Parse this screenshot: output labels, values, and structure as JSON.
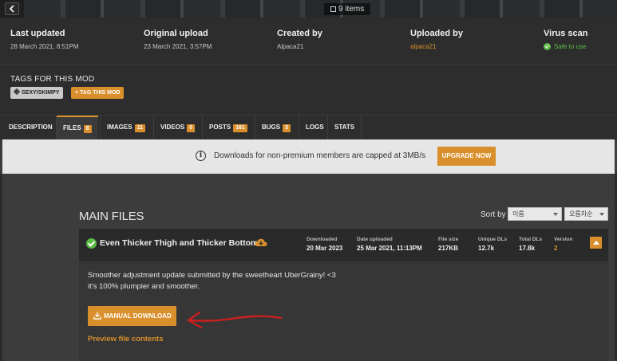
{
  "gallery": {
    "count": "9 items"
  },
  "meta": {
    "last_updated": {
      "label": "Last updated",
      "value": "28 March 2021,  8:51PM"
    },
    "original_upload": {
      "label": "Original upload",
      "value": "23 March 2021,  3:57PM"
    },
    "created_by": {
      "label": "Created by",
      "value": "Alpaca21"
    },
    "uploaded_by": {
      "label": "Uploaded by",
      "value": "alpaca21"
    },
    "virus_scan": {
      "label": "Virus scan",
      "value": "Safe to use"
    }
  },
  "tags": {
    "heading": "TAGS FOR THIS MOD",
    "items": [
      "SEXY/SKIMPY"
    ],
    "add_label": "TAG THIS MOD"
  },
  "tabs": [
    {
      "label": "DESCRIPTION",
      "badge": ""
    },
    {
      "label": "FILES",
      "badge": "8"
    },
    {
      "label": "IMAGES",
      "badge": "11"
    },
    {
      "label": "VIDEOS",
      "badge": "0"
    },
    {
      "label": "POSTS",
      "badge": "161"
    },
    {
      "label": "BUGS",
      "badge": "3"
    },
    {
      "label": "LOGS",
      "badge": ""
    },
    {
      "label": "STATS",
      "badge": ""
    }
  ],
  "banner": {
    "message": "Downloads for non-premium members are capped at 3MB/s",
    "button": "UPGRADE NOW"
  },
  "files": {
    "section_title": "MAIN FILES",
    "sort_label": "Sort by",
    "sort_field": "이름",
    "sort_order": "오름차순",
    "file": {
      "name": "Even Thicker Thigh and Thicker Bottom",
      "stats": {
        "downloaded": {
          "label": "Downloaded",
          "value": "20 Mar 2023"
        },
        "date_uploaded": {
          "label": "Date uploaded",
          "value": "25 Mar 2021, 11:13PM"
        },
        "file_size": {
          "label": "File size",
          "value": "217KB"
        },
        "unique_dls": {
          "label": "Unique DLs",
          "value": "12.7k"
        },
        "total_dls": {
          "label": "Total DLs",
          "value": "17.8k"
        },
        "version": {
          "label": "Version",
          "value": "2"
        }
      },
      "description_line1": "Smoother adjustment update submitted by the sweetheart UberGrainy! <3",
      "description_line2": "it's 100% plumpier and smoother.",
      "download_button": "MANUAL DOWNLOAD",
      "preview_link": "Preview file contents"
    }
  },
  "colors": {
    "accent": "#d98f2b",
    "success": "#5dbb46",
    "annotation": "#cc1f1f"
  },
  "icons": [
    "back-arrow-icon",
    "image-icon",
    "check-circle-icon",
    "tag-icon",
    "plus-icon",
    "info-icon",
    "cloud-download-icon",
    "chevron-up-icon",
    "download-icon",
    "dropdown-caret-icon"
  ]
}
